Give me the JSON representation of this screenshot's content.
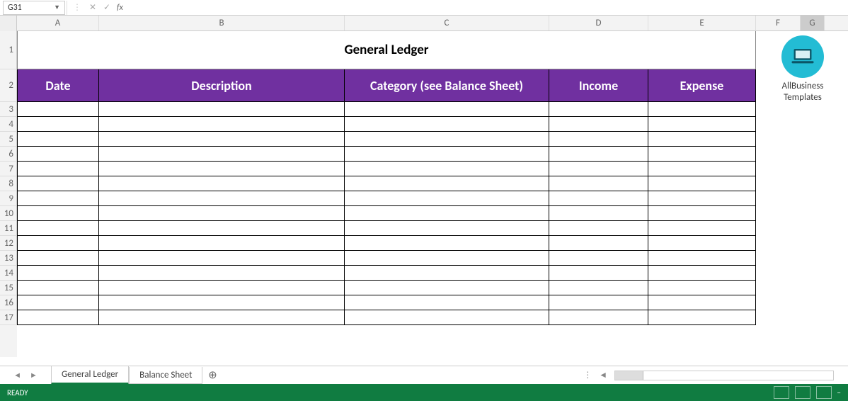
{
  "formula_bar": {
    "name_box": "G31",
    "fx_label": "fx"
  },
  "columns": [
    "A",
    "B",
    "C",
    "D",
    "E",
    "F",
    "G"
  ],
  "rows": [
    "1",
    "2",
    "3",
    "4",
    "5",
    "6",
    "7",
    "8",
    "9",
    "10",
    "11",
    "12",
    "13",
    "14",
    "15",
    "16",
    "17"
  ],
  "sheet": {
    "title": "General Ledger",
    "headers": {
      "date": "Date",
      "description": "Description",
      "category": "Category (see Balance Sheet)",
      "income": "Income",
      "expense": "Expense"
    }
  },
  "brand": {
    "line1": "AllBusiness",
    "line2": "Templates"
  },
  "tabs": {
    "active": "General Ledger",
    "other": "Balance Sheet"
  },
  "status": {
    "ready": "READY"
  }
}
